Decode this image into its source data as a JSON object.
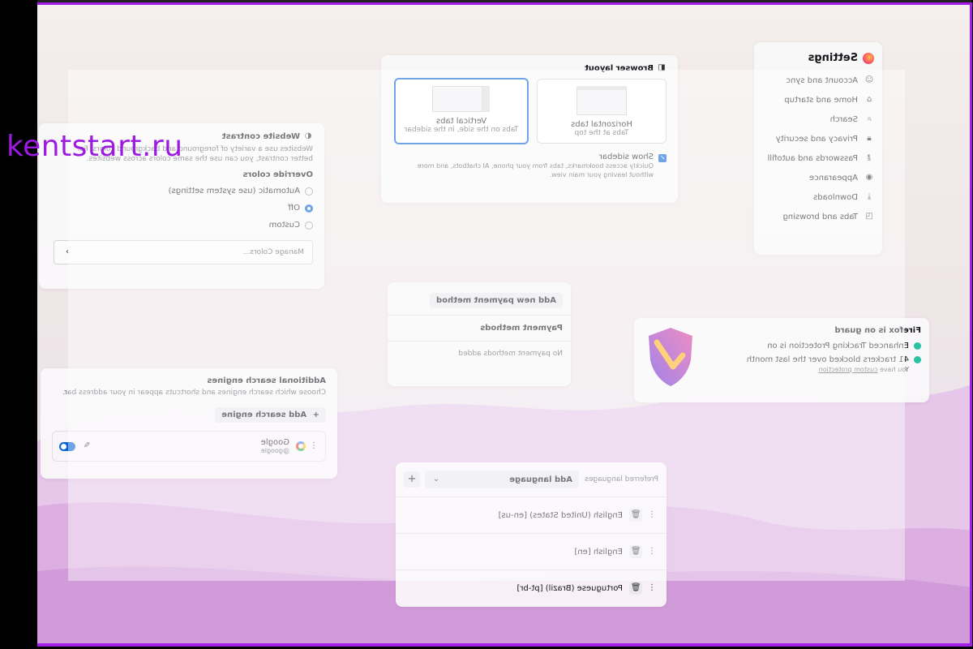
{
  "watermark": "kentstart.ru",
  "colors": {
    "accent": "#0a63d6",
    "frame": "#a31ee6",
    "watermark": "#9d1ae0"
  },
  "settings_nav": {
    "title": "Settings",
    "items": [
      {
        "label": "Account and sync",
        "icon": "account-icon"
      },
      {
        "label": "Home and startup",
        "icon": "home-icon"
      },
      {
        "label": "Search",
        "icon": "search-icon"
      },
      {
        "label": "Privacy and security",
        "icon": "lock-icon"
      },
      {
        "label": "Passwords and autofill",
        "icon": "key-icon"
      },
      {
        "label": "Appearance",
        "icon": "eye-icon"
      },
      {
        "label": "Downloads",
        "icon": "download-icon"
      },
      {
        "label": "Tabs and browsing",
        "icon": "tabs-icon"
      }
    ]
  },
  "browser_layout": {
    "title": "Browser layout",
    "options": [
      {
        "title": "Horizontal tabs",
        "desc": "Tabs at the top",
        "selected": false
      },
      {
        "title": "Vertical tabs",
        "desc": "Tabs on the side, in the sidebar",
        "selected": true
      }
    ],
    "show_sidebar_label": "Show sidebar",
    "show_sidebar_desc": "Quickly access bookmarks, tabs from your phone, AI chatbots, and more without leaving your main view."
  },
  "website_contrast": {
    "title": "Website contrast",
    "desc": "Websites use a variety of foreground and background colors. For better contrast, you can use the same colors across websites.",
    "override_title": "Override colors",
    "options": [
      {
        "label": "Automatic (use system settings)",
        "selected": false
      },
      {
        "label": "Off",
        "selected": true
      },
      {
        "label": "Custom",
        "selected": false
      }
    ],
    "manage_label": "Manage Colors..."
  },
  "payments": {
    "add_label": "Add new payment method",
    "header": "Payment methods",
    "empty": "No payment methods added"
  },
  "guard": {
    "title": "Firefox is on guard",
    "items": [
      "Enhanced Tracking Protection is on",
      "41 trackers blocked over the last month"
    ],
    "note_prefix": "You have",
    "note_link": "custom protection"
  },
  "search_engines": {
    "title": "Additional search engines",
    "desc": "Choose which search engines and shortcuts appear in your address bar.",
    "add_label": "Add search engine",
    "engine_name": "Google",
    "engine_alias": "@google",
    "enabled": true
  },
  "languages": {
    "title": "Preferred languages",
    "add_label": "Add language",
    "items": [
      "English (United States) [en-us]",
      "English [en]",
      "Portuguese (Brazil) [pt-br]"
    ]
  }
}
